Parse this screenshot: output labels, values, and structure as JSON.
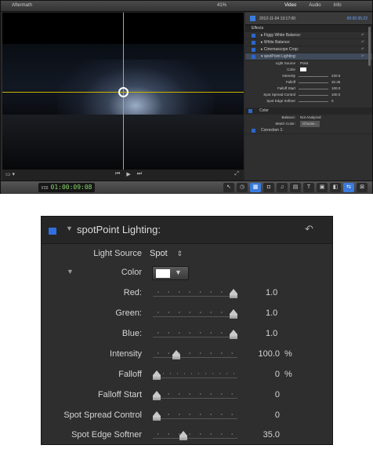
{
  "window": {
    "project_name": "Aftermath",
    "viewer_zoom": "41%",
    "inspector_tabs": [
      "Video",
      "Audio",
      "Info"
    ],
    "clip_timestamp": "2012-11-04 13:17:00",
    "clip_duration": "00:00:35:22",
    "timecode_tag": "VID",
    "timecode": "01:00:09:08"
  },
  "inspector_small": {
    "section_effects": "Effects",
    "effects": [
      {
        "label": "Figgy White Balance:"
      },
      {
        "label": "White Balance:"
      },
      {
        "label": "Cinemascope Crop:"
      },
      {
        "label": "spotPoint Lighting:"
      }
    ],
    "params": [
      {
        "label": "Light Source",
        "value": "Point"
      },
      {
        "label": "Color",
        "value": ""
      },
      {
        "label": "Intensity",
        "value": "220.6"
      },
      {
        "label": "Falloff",
        "value": "32.36"
      },
      {
        "label": "Falloff Start",
        "value": "100.0"
      },
      {
        "label": "Spot Spread Control",
        "value": "100.0"
      },
      {
        "label": "Spot Edge Softner",
        "value": "0"
      }
    ],
    "section_color": "Color",
    "balance_label": "Balance:",
    "balance_value": "Not Analyzed",
    "match_color_label": "Match Color:",
    "choose_label": "Choose...",
    "correction_label": "Correction 1:"
  },
  "zoom": {
    "effect_title": "spotPoint Lighting:",
    "light_source_label": "Light Source",
    "light_source_value": "Spot",
    "color_label": "Color",
    "color_swatch": "#ffffff",
    "rows": [
      {
        "label": "Red:",
        "value": "1.0",
        "unit": "",
        "position": 1.0
      },
      {
        "label": "Green:",
        "value": "1.0",
        "unit": "",
        "position": 1.0
      },
      {
        "label": "Blue:",
        "value": "1.0",
        "unit": "",
        "position": 1.0
      },
      {
        "label": "Intensity",
        "value": "100.0",
        "unit": "%",
        "position": 0.25
      },
      {
        "label": "Falloff",
        "value": "0",
        "unit": "%",
        "position": 0.0
      },
      {
        "label": "Falloff Start",
        "value": "0",
        "unit": "",
        "position": 0.0
      },
      {
        "label": "Spot Spread Control",
        "value": "0",
        "unit": "",
        "position": 0.0
      },
      {
        "label": "Spot Edge Softner",
        "value": "35.0",
        "unit": "",
        "position": 0.35
      }
    ]
  },
  "colors": {
    "accent_blue": "#2f70e0",
    "crosshair": "#c8b400",
    "timecode_green": "#8ad86c"
  }
}
